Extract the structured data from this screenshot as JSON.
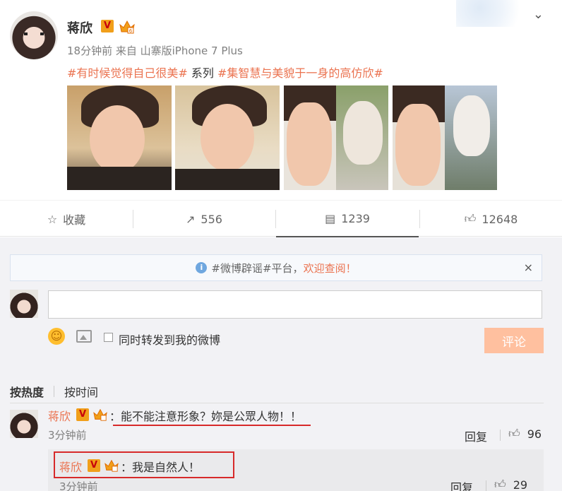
{
  "post": {
    "author": "蒋欣",
    "verified_badge": "V",
    "meta": "18分钟前 来自 山寨版iPhone 7 Plus",
    "topic1": "#有时候觉得自己很美#",
    "topic_mid": " 系列 ",
    "topic2": "#集智慧与美貌于一身的高仿欣#",
    "more_icon": "chevron-down-icon"
  },
  "actions": {
    "favorite_label": "收藏",
    "repost_count": "556",
    "comment_count": "1239",
    "like_count": "12648"
  },
  "notice": {
    "text": "#微博辟谣#平台，",
    "highlight": "欢迎查阅！",
    "close": "×"
  },
  "composer": {
    "repost_label": "同时转发到我的微博",
    "submit_label": "评论"
  },
  "sort": {
    "hot": "按热度",
    "time": "按时间"
  },
  "comments": [
    {
      "author": "蒋欣",
      "text": "：能不能注意形象？妳是公眾人物！！",
      "time": "3分钟前",
      "reply_label": "回复",
      "likes": "96"
    }
  ],
  "reply": {
    "author": "蒋欣",
    "text": "：我是自然人！",
    "time": "3分钟前",
    "reply_label": "回复",
    "likes": "29"
  },
  "colors": {
    "accent": "#eb7350",
    "badge": "#f19f1a",
    "submit": "#ffc09f",
    "annotation_red": "#d72a2a"
  }
}
